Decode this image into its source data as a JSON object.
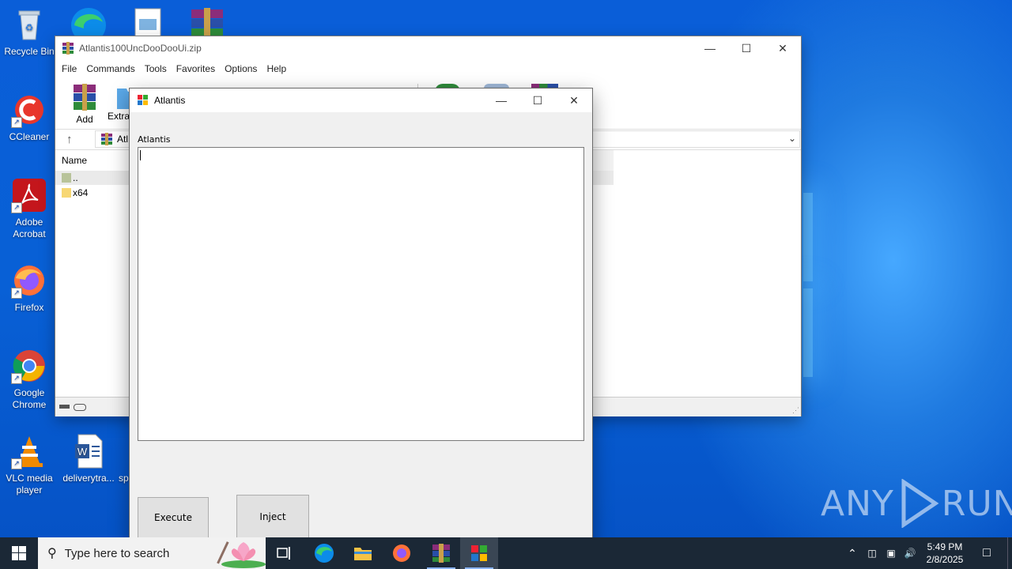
{
  "desktop": {
    "icons": [
      {
        "label": "Recycle Bin"
      },
      {
        "label": "CCleaner"
      },
      {
        "label": "Adobe Acrobat"
      },
      {
        "label": "Firefox"
      },
      {
        "label": "Google Chrome"
      },
      {
        "label": "VLC media player"
      },
      {
        "label": "deliverytra..."
      },
      {
        "label": "sp"
      }
    ]
  },
  "winrar": {
    "title": "Atlantis100UncDooDooUi.zip",
    "menu": [
      "File",
      "Commands",
      "Tools",
      "Favorites",
      "Options",
      "Help"
    ],
    "toolbar": {
      "add": "Add",
      "extract": "Extra"
    },
    "path_prefix": "Atl",
    "columns": {
      "name": "Name"
    },
    "files": [
      {
        "name": ".."
      },
      {
        "name": "x64"
      }
    ]
  },
  "dialog": {
    "title": "Atlantis",
    "label": "Atlantis",
    "textbox_value": "",
    "execute_label": "Execute",
    "inject_label": "Inject"
  },
  "taskbar": {
    "search_placeholder": "Type here to search",
    "time": "5:49 PM",
    "date": "2/8/2025"
  },
  "watermark": {
    "text_left": "ANY",
    "text_right": "RUN"
  },
  "colors": {
    "desktop_blue": "#0a5ed8",
    "taskbar": "#1b2836",
    "dialog_bg": "#f0f0f0"
  }
}
